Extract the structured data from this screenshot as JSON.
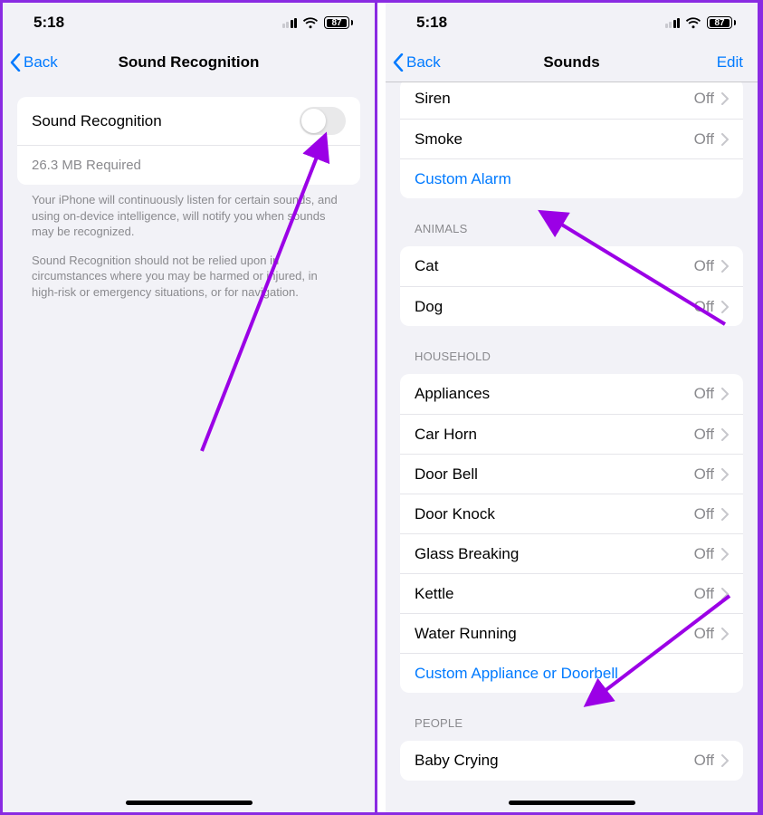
{
  "status": {
    "time": "5:18",
    "battery_pct": "87"
  },
  "left": {
    "back": "Back",
    "title": "Sound Recognition",
    "toggle_label": "Sound Recognition",
    "footer_text": "26.3 MB Required",
    "desc1": "Your iPhone will continuously listen for certain sounds, and using on-device intelligence, will notify you when sounds may be recognized.",
    "desc2": "Sound Recognition should not be relied upon in circumstances where you may be harmed or injured, in high-risk or emergency situations, or for navigation."
  },
  "right": {
    "back": "Back",
    "title": "Sounds",
    "edit": "Edit",
    "status_off": "Off",
    "alarms_items": [
      {
        "label": "Siren"
      },
      {
        "label": "Smoke"
      }
    ],
    "alarms_custom": "Custom Alarm",
    "animals_header": "ANIMALS",
    "animals_items": [
      {
        "label": "Cat"
      },
      {
        "label": "Dog"
      }
    ],
    "household_header": "HOUSEHOLD",
    "household_items": [
      {
        "label": "Appliances"
      },
      {
        "label": "Car Horn"
      },
      {
        "label": "Door Bell"
      },
      {
        "label": "Door Knock"
      },
      {
        "label": "Glass Breaking"
      },
      {
        "label": "Kettle"
      },
      {
        "label": "Water Running"
      }
    ],
    "household_custom": "Custom Appliance or Doorbell",
    "people_header": "PEOPLE",
    "people_items": [
      {
        "label": "Baby Crying"
      }
    ]
  }
}
